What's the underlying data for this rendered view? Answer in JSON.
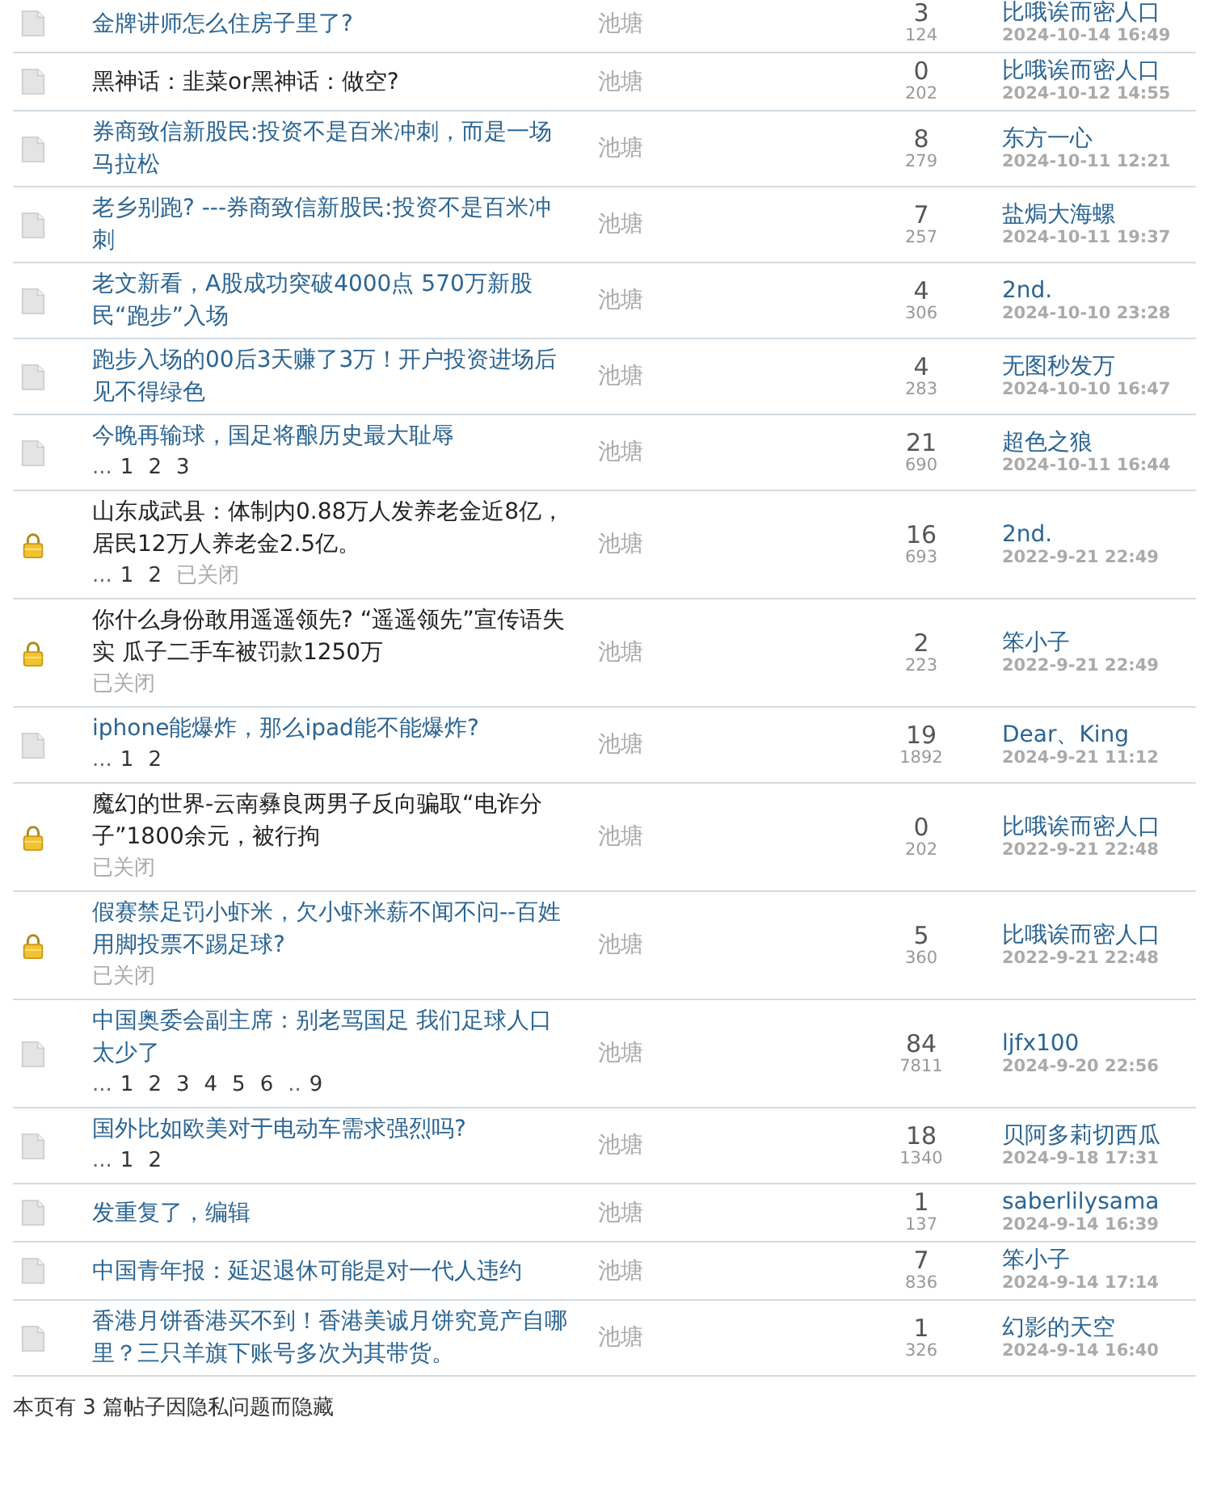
{
  "threads": [
    {
      "kind": "normal",
      "title": "金牌讲师怎么住房子里了?",
      "visited": false,
      "author": "池塘",
      "replies": "3",
      "views": "124",
      "last_poster": "比哦诶而密人口",
      "last_time": "2024-10-14 16:49"
    },
    {
      "kind": "normal",
      "title": "黑神话：韭菜or黑神话：做空?",
      "visited": true,
      "author": "池塘",
      "replies": "0",
      "views": "202",
      "last_poster": "比哦诶而密人口",
      "last_time": "2024-10-12 14:55"
    },
    {
      "kind": "normal",
      "title": "券商致信新股民:投资不是百米冲刺，而是一场马拉松",
      "visited": false,
      "author": "池塘",
      "replies": "8",
      "views": "279",
      "last_poster": "东方一心",
      "last_time": "2024-10-11 12:21"
    },
    {
      "kind": "normal",
      "title": "老乡别跑? ---券商致信新股民:投资不是百米冲刺",
      "visited": false,
      "author": "池塘",
      "replies": "7",
      "views": "257",
      "last_poster": "盐焗大海螺",
      "last_time": "2024-10-11 19:37"
    },
    {
      "kind": "normal",
      "title": "老文新看，A股成功突破4000点 570万新股民“跑步”入场",
      "visited": false,
      "author": "池塘",
      "replies": "4",
      "views": "306",
      "last_poster": "2nd.",
      "last_time": "2024-10-10 23:28"
    },
    {
      "kind": "normal",
      "title": "跑步入场的00后3天赚了3万！开户投资进场后见不得绿色",
      "visited": false,
      "author": "池塘",
      "replies": "4",
      "views": "283",
      "last_poster": "无图秒发万",
      "last_time": "2024-10-10 16:47"
    },
    {
      "kind": "normal",
      "title": "今晚再输球，国足将酿历史最大耻辱",
      "visited": false,
      "pages": [
        {
          "text": "...",
          "kind": "gap"
        },
        {
          "text": "1",
          "kind": "page"
        },
        {
          "text": "2",
          "kind": "page"
        },
        {
          "text": "3",
          "kind": "page"
        }
      ],
      "author": "池塘",
      "replies": "21",
      "views": "690",
      "last_poster": "超色之狼",
      "last_time": "2024-10-11 16:44"
    },
    {
      "kind": "locked",
      "title": "山东成武县：体制内0.88万人发养老金近8亿，居民12万人养老金2.5亿。",
      "visited": true,
      "pages": [
        {
          "text": "...",
          "kind": "gap"
        },
        {
          "text": "1",
          "kind": "page"
        },
        {
          "text": "2",
          "kind": "page"
        }
      ],
      "closed_label": "已关闭",
      "author": "池塘",
      "replies": "16",
      "views": "693",
      "last_poster": "2nd.",
      "last_time": "2022-9-21 22:49"
    },
    {
      "kind": "locked",
      "title": "你什么身份敢用遥遥领先? “遥遥领先”宣传语失实 瓜子二手车被罚款1250万",
      "visited": true,
      "closed_label": "已关闭",
      "author": "池塘",
      "replies": "2",
      "views": "223",
      "last_poster": "笨小子",
      "last_time": "2022-9-21 22:49"
    },
    {
      "kind": "normal",
      "title": "iphone能爆炸，那么ipad能不能爆炸?",
      "visited": false,
      "pages": [
        {
          "text": "...",
          "kind": "gap"
        },
        {
          "text": "1",
          "kind": "page"
        },
        {
          "text": "2",
          "kind": "page"
        }
      ],
      "author": "池塘",
      "replies": "19",
      "views": "1892",
      "last_poster": "Dear、King",
      "last_time": "2024-9-21 11:12"
    },
    {
      "kind": "locked",
      "title": "魔幻的世界-云南彝良两男子反向骗取“电诈分子”1800余元，被行拘",
      "visited": true,
      "closed_label": "已关闭",
      "author": "池塘",
      "replies": "0",
      "views": "202",
      "last_poster": "比哦诶而密人口",
      "last_time": "2022-9-21 22:48"
    },
    {
      "kind": "locked",
      "title": "假赛禁足罚小虾米，欠小虾米薪不闻不问--百姓用脚投票不踢足球?",
      "visited": false,
      "closed_label": "已关闭",
      "author": "池塘",
      "replies": "5",
      "views": "360",
      "last_poster": "比哦诶而密人口",
      "last_time": "2022-9-21 22:48"
    },
    {
      "kind": "normal",
      "title": "中国奥委会副主席：别老骂国足 我们足球人口太少了",
      "visited": false,
      "pages": [
        {
          "text": "...",
          "kind": "gap"
        },
        {
          "text": "1",
          "kind": "page"
        },
        {
          "text": "2",
          "kind": "page"
        },
        {
          "text": "3",
          "kind": "page"
        },
        {
          "text": "4",
          "kind": "page"
        },
        {
          "text": "5",
          "kind": "page"
        },
        {
          "text": "6",
          "kind": "page"
        },
        {
          "text": "..",
          "kind": "gap"
        },
        {
          "text": "9",
          "kind": "page"
        }
      ],
      "author": "池塘",
      "replies": "84",
      "views": "7811",
      "last_poster": "ljfx100",
      "last_time": "2024-9-20 22:56"
    },
    {
      "kind": "normal",
      "title": "国外比如欧美对于电动车需求强烈吗?",
      "visited": false,
      "pages": [
        {
          "text": "...",
          "kind": "gap"
        },
        {
          "text": "1",
          "kind": "page"
        },
        {
          "text": "2",
          "kind": "page"
        }
      ],
      "author": "池塘",
      "replies": "18",
      "views": "1340",
      "last_poster": "贝阿多莉切西瓜",
      "last_time": "2024-9-18 17:31"
    },
    {
      "kind": "normal",
      "title": "发重复了，编辑",
      "visited": false,
      "author": "池塘",
      "replies": "1",
      "views": "137",
      "last_poster": "saberlilysama",
      "last_time": "2024-9-14 16:39"
    },
    {
      "kind": "normal",
      "title": "中国青年报：延迟退休可能是对一代人违约",
      "visited": false,
      "author": "池塘",
      "replies": "7",
      "views": "836",
      "last_poster": "笨小子",
      "last_time": "2024-9-14 17:14"
    },
    {
      "kind": "normal",
      "title": "香港月饼香港买不到！香港美诚月饼究竟产自哪里？三只羊旗下账号多次为其带货。",
      "visited": false,
      "author": "池塘",
      "replies": "1",
      "views": "326",
      "last_poster": "幻影的天空",
      "last_time": "2024-9-14 16:40"
    }
  ],
  "footer_note": "本页有 3 篇帖子因隐私问题而隐藏"
}
